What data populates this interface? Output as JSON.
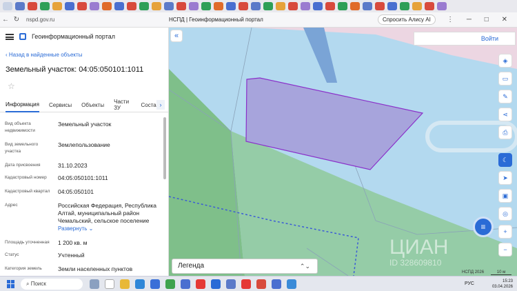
{
  "browser": {
    "url": "nspd.gov.ru",
    "title": "НСПД | Геоинформационный портал",
    "ask_alice": "Спросить Алису AI"
  },
  "panel": {
    "title": "Геоинформационный портал",
    "back": "Назад в найденные объекты",
    "heading": "Земельный участок: 04:05:050101:1011",
    "tabs": [
      "Информация",
      "Сервисы",
      "Объекты",
      "Части ЗУ",
      "Состав"
    ],
    "rows": [
      {
        "label": "Вид объекта недвижимости",
        "value": "Земельный участок"
      },
      {
        "label": "Вид земельного участка",
        "value": "Землепользование"
      },
      {
        "label": "Дата присвоения",
        "value": "31.10.2023"
      },
      {
        "label": "Кадастровый номер",
        "value": "04:05:050101:1011"
      },
      {
        "label": "Кадастровый квартал",
        "value": "04:05:050101"
      },
      {
        "label": "Адрес",
        "value": "Российская Федерация, Республика Алтай, муниципальный район Чемальский, сельское поселение"
      },
      {
        "label": "Площадь уточненная",
        "value": "1 200 кв. м"
      },
      {
        "label": "Статус",
        "value": "Учтенный"
      },
      {
        "label": "Категория земель",
        "value": "Земли населенных пунктов"
      }
    ],
    "expand": "Развернуть"
  },
  "map": {
    "login": "Войти",
    "legend": "Легенда",
    "copyright": "НСПД 2026",
    "scale": "10 м",
    "watermark": "ЦИАН",
    "watermark_id": "ID 328609810"
  },
  "taskbar": {
    "search": "Поиск",
    "lang": "РУС",
    "time": "15:23",
    "date": "03.04.2026"
  },
  "colors": {
    "accent": "#2a6bd6",
    "parcel_fill": "#a7a4dc",
    "parcel_stroke": "#8a2fc9",
    "green_zone": "#7fbf8a",
    "water": "#b3d9ef",
    "pink_zone": "#ecd6e2"
  }
}
